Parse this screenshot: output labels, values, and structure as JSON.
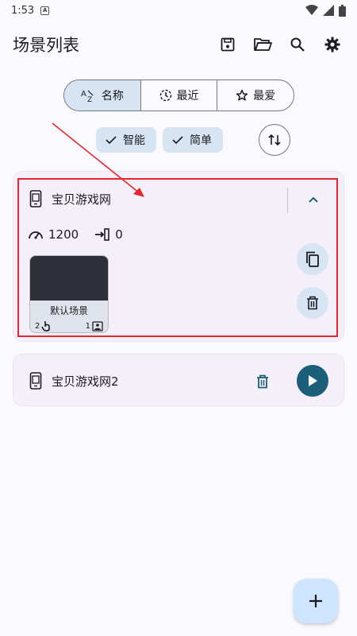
{
  "status_bar": {
    "time": "1:53",
    "notif_letter": "A"
  },
  "app_bar": {
    "title": "场景列表",
    "actions": [
      "save-icon",
      "folder-open-icon",
      "search-icon",
      "gear-icon"
    ]
  },
  "sort_tabs": [
    {
      "label": "名称",
      "icon": "az-icon",
      "active": true
    },
    {
      "label": "最近",
      "icon": "clock-icon",
      "active": false
    },
    {
      "label": "最爱",
      "icon": "star-icon",
      "active": false
    }
  ],
  "filters": [
    {
      "label": "智能",
      "checked": true
    },
    {
      "label": "简单",
      "checked": true
    }
  ],
  "cards": [
    {
      "name": "宝贝游戏网",
      "expanded": true,
      "interval": "1200",
      "count": "0",
      "scene": {
        "name": "默认场景",
        "touch_count": "2",
        "image_count": "1"
      }
    },
    {
      "name": "宝贝游戏网2",
      "expanded": false
    }
  ],
  "colors": {
    "accent": "#1d5e7b",
    "tonal": "#d6e4f4",
    "card": "#f4eff8",
    "highlight": "#e8262e",
    "fab": "#cde5ff"
  }
}
